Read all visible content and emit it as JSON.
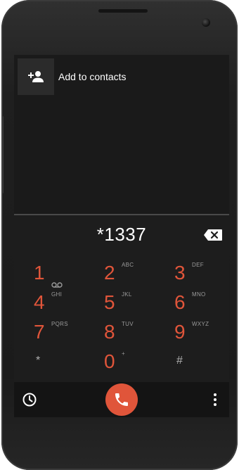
{
  "header": {
    "add_contact_label": "Add to contacts"
  },
  "dial": {
    "number": "*1337"
  },
  "keypad": [
    {
      "num": "1",
      "letters": ""
    },
    {
      "num": "2",
      "letters": "ABC"
    },
    {
      "num": "3",
      "letters": "DEF"
    },
    {
      "num": "4",
      "letters": "GHI"
    },
    {
      "num": "5",
      "letters": "JKL"
    },
    {
      "num": "6",
      "letters": "MNO"
    },
    {
      "num": "7",
      "letters": "PQRS"
    },
    {
      "num": "8",
      "letters": "TUV"
    },
    {
      "num": "9",
      "letters": "WXYZ"
    },
    {
      "num": "*",
      "letters": ""
    },
    {
      "num": "0",
      "letters": "+"
    },
    {
      "num": "#",
      "letters": ""
    }
  ],
  "icons": {
    "add_contact": "person-add-icon",
    "backspace": "backspace-icon",
    "voicemail": "voicemail-icon",
    "history": "clock-icon",
    "call": "phone-icon",
    "overflow": "more-vert-icon"
  },
  "colors": {
    "accent": "#e0553a",
    "screen_bg": "#1d1d1d",
    "text": "#ffffff",
    "subtext": "#9a9a9a"
  }
}
